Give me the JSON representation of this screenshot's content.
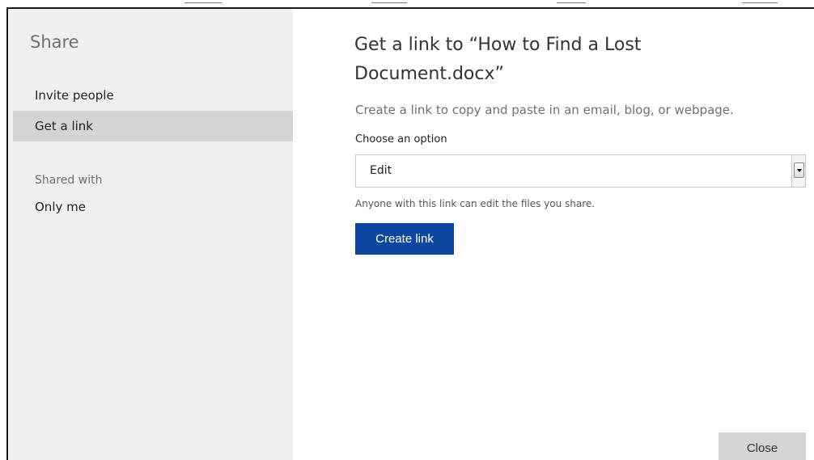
{
  "dialog": {
    "title": "Share"
  },
  "sidebar": {
    "items": [
      {
        "label": "Invite people"
      },
      {
        "label": "Get a link"
      }
    ],
    "shared_with_label": "Shared with",
    "shared_with_value": "Only me"
  },
  "main": {
    "title": "Get a link to “How to Find a Lost Document.docx”",
    "subtitle": "Create a link to copy and paste in an email, blog, or webpage.",
    "option_label": "Choose an option",
    "selected_option": "Edit",
    "hint": "Anyone with this link can edit the files you share.",
    "create_button": "Create link",
    "close_button": "Close"
  },
  "colors": {
    "sidebar_bg": "#f0f0f0",
    "active_item_bg": "#d4d4d4",
    "primary_button": "#0e47a1",
    "secondary_button": "#d5d5d5"
  }
}
